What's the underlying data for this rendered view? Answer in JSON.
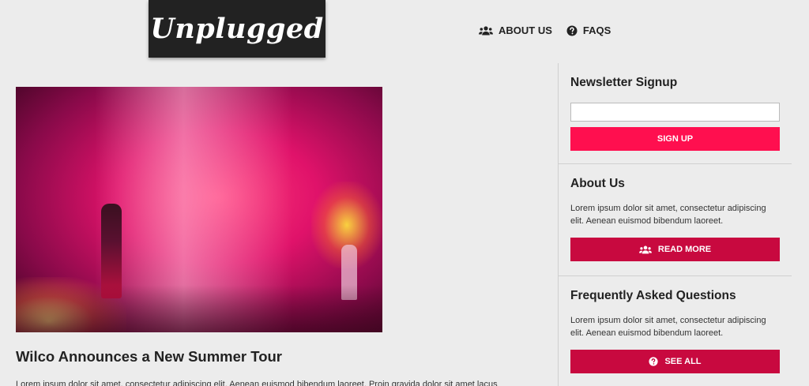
{
  "brand": {
    "logo_text": "Unplugged"
  },
  "nav": {
    "items": [
      {
        "label": "ABOUT US",
        "icon": "users-icon"
      },
      {
        "label": "FAQS",
        "icon": "question-circle-icon"
      }
    ]
  },
  "article": {
    "headline": "Wilco Announces a New Summer Tour",
    "excerpt": "Lorem ipsum dolor sit amet, consectetur adipiscing elit. Aenean euismod bibendum laoreet. Proin gravida dolor sit amet lacus"
  },
  "sidebar": {
    "newsletter": {
      "title": "Newsletter Signup",
      "input_value": "",
      "button_label": "SIGN UP"
    },
    "about": {
      "title": "About Us",
      "body": "Lorem ipsum dolor sit amet, consectetur adipiscing elit. Aenean euismod bibendum laoreet.",
      "button_label": "READ MORE",
      "button_icon": "users-icon"
    },
    "faq": {
      "title": "Frequently Asked Questions",
      "body": "Lorem ipsum dolor sit amet, consectetur adipiscing elit. Aenean euismod bibendum laoreet.",
      "button_label": "SEE ALL",
      "button_icon": "question-circle-icon"
    }
  },
  "colors": {
    "accent": "#ff0f4f",
    "accent_dark": "#c8093f",
    "logo_bg": "#222222",
    "page_bg": "#ececec"
  }
}
